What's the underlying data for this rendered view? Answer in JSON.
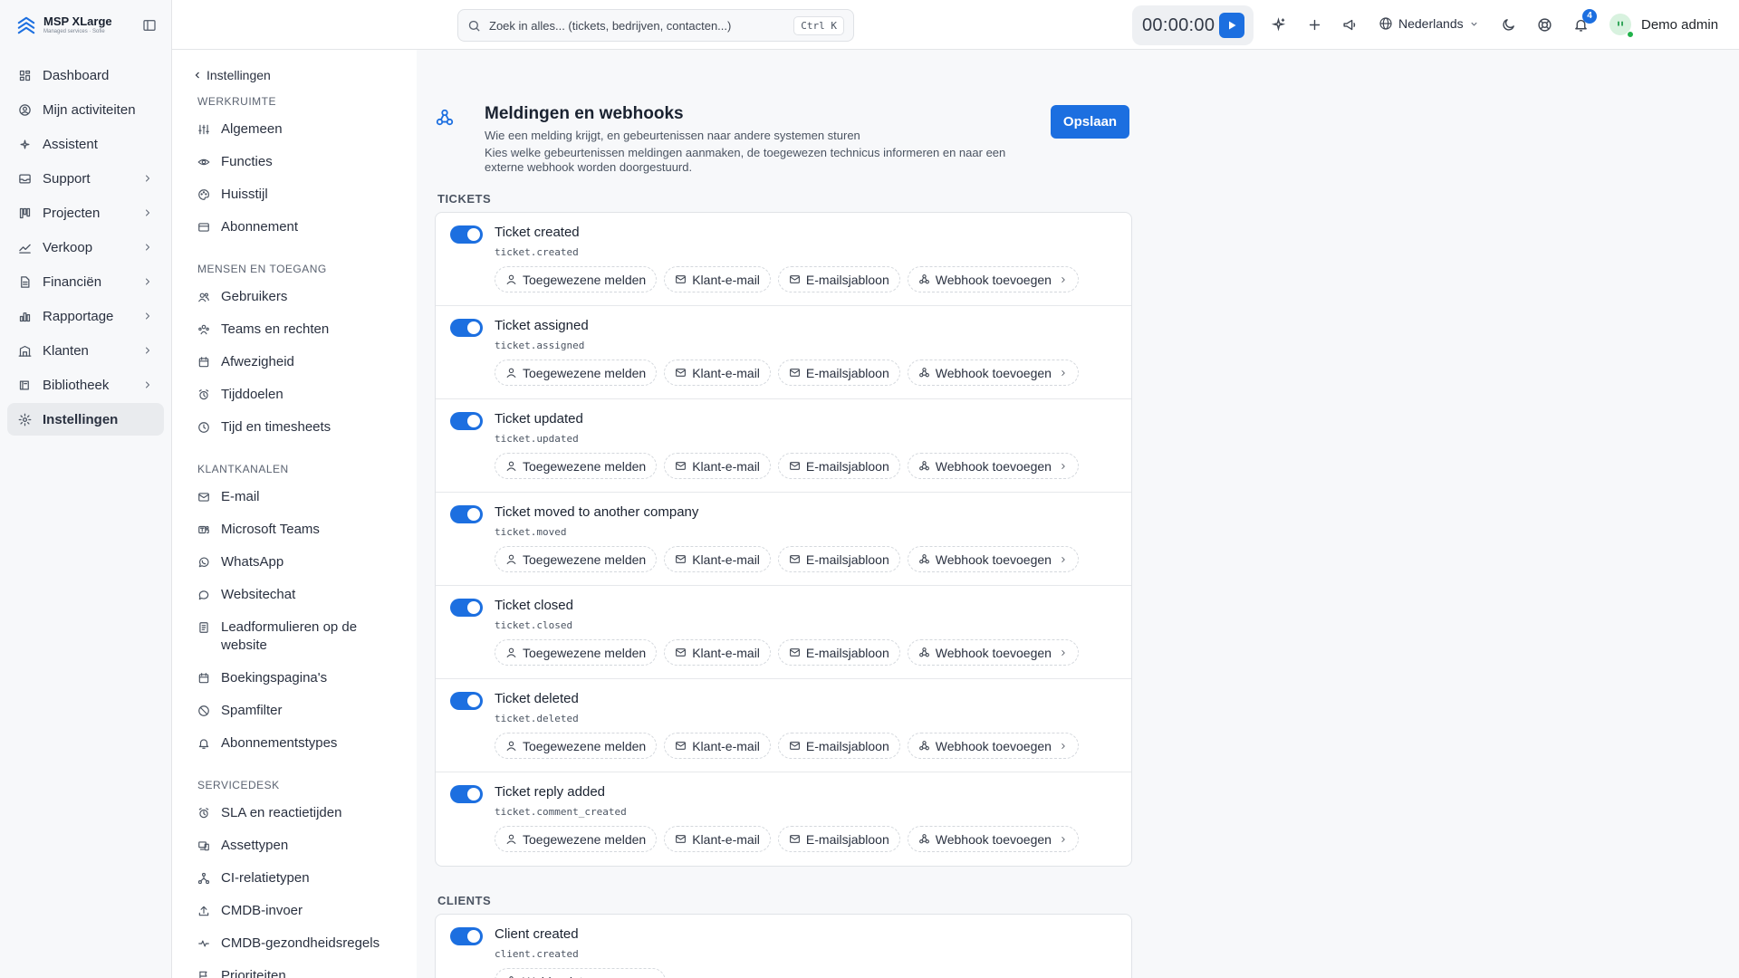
{
  "brand": {
    "name": "MSP XLarge",
    "subtitle": "Managed services · Sofie"
  },
  "sidebar": {
    "items": [
      {
        "label": "Dashboard",
        "icon": "dashboard-icon",
        "has_children": false,
        "active": false
      },
      {
        "label": "Mijn activiteiten",
        "icon": "user-circle-icon",
        "has_children": false,
        "active": false
      },
      {
        "label": "Assistent",
        "icon": "sparkle-icon",
        "has_children": false,
        "active": false
      },
      {
        "label": "Support",
        "icon": "inbox-icon",
        "has_children": true,
        "active": false
      },
      {
        "label": "Projecten",
        "icon": "kanban-icon",
        "has_children": true,
        "active": false
      },
      {
        "label": "Verkoop",
        "icon": "trend-icon",
        "has_children": true,
        "active": false
      },
      {
        "label": "Financiën",
        "icon": "document-icon",
        "has_children": true,
        "active": false
      },
      {
        "label": "Rapportage",
        "icon": "bar-chart-icon",
        "has_children": true,
        "active": false
      },
      {
        "label": "Klanten",
        "icon": "building-icon",
        "has_children": true,
        "active": false
      },
      {
        "label": "Bibliotheek",
        "icon": "book-icon",
        "has_children": true,
        "active": false
      },
      {
        "label": "Instellingen",
        "icon": "gear-icon",
        "has_children": false,
        "active": true
      }
    ]
  },
  "topbar": {
    "search_placeholder": "Zoek in alles... (tickets, bedrijven, contacten...)",
    "shortcut": "Ctrl K",
    "timer": "00:00:00",
    "language": "Nederlands",
    "notification_count": "4",
    "user_name": "Demo admin"
  },
  "subnav": {
    "back_label": "Instellingen",
    "groups": [
      {
        "title": "WERKRUIMTE",
        "items": [
          {
            "label": "Algemeen",
            "icon": "sliders-icon"
          },
          {
            "label": "Functies",
            "icon": "eye-icon"
          },
          {
            "label": "Huisstijl",
            "icon": "palette-icon"
          },
          {
            "label": "Abonnement",
            "icon": "card-icon"
          }
        ]
      },
      {
        "title": "MENSEN EN TOEGANG",
        "items": [
          {
            "label": "Gebruikers",
            "icon": "users-icon"
          },
          {
            "label": "Teams en rechten",
            "icon": "team-icon"
          },
          {
            "label": "Afwezigheid",
            "icon": "calendar-icon"
          },
          {
            "label": "Tijddoelen",
            "icon": "alarm-icon"
          },
          {
            "label": "Tijd en timesheets",
            "icon": "clock-icon"
          }
        ]
      },
      {
        "title": "KLANTKANALEN",
        "items": [
          {
            "label": "E-mail",
            "icon": "mail-icon"
          },
          {
            "label": "Microsoft Teams",
            "icon": "teams-icon"
          },
          {
            "label": "WhatsApp",
            "icon": "whatsapp-icon"
          },
          {
            "label": "Websitechat",
            "icon": "chat-icon"
          },
          {
            "label": "Leadformulieren op de website",
            "icon": "form-icon"
          },
          {
            "label": "Boekingspagina's",
            "icon": "calendar-icon"
          },
          {
            "label": "Spamfilter",
            "icon": "ban-icon"
          },
          {
            "label": "Abonnementstypes",
            "icon": "bell-icon"
          }
        ]
      },
      {
        "title": "SERVICEDESK",
        "items": [
          {
            "label": "SLA en reactietijden",
            "icon": "alarm-icon"
          },
          {
            "label": "Assettypen",
            "icon": "devices-icon"
          },
          {
            "label": "CI-relatietypen",
            "icon": "network-icon"
          },
          {
            "label": "CMDB-invoer",
            "icon": "upload-icon"
          },
          {
            "label": "CMDB-gezondheidsregels",
            "icon": "pulse-icon"
          },
          {
            "label": "Prioriteiten",
            "icon": "flag-icon"
          }
        ]
      }
    ]
  },
  "main": {
    "title": "Meldingen en webhooks",
    "subtitle": "Wie een melding krijgt, en gebeurtenissen naar andere systemen sturen",
    "description": "Kies welke gebeurtenissen meldingen aanmaken, de toegewezen technicus informeren en naar een externe webhook worden doorgestuurd.",
    "save_label": "Opslaan",
    "chip_labels": {
      "notify_assignee": "Toegewezene melden",
      "client_email": "Klant-e-mail",
      "email_template": "E-mailsjabloon",
      "add_webhook": "Webhook toevoegen"
    },
    "sections": [
      {
        "title": "TICKETS",
        "events": [
          {
            "title": "Ticket created",
            "code": "ticket.created",
            "enabled": true
          },
          {
            "title": "Ticket assigned",
            "code": "ticket.assigned",
            "enabled": true
          },
          {
            "title": "Ticket updated",
            "code": "ticket.updated",
            "enabled": true
          },
          {
            "title": "Ticket moved to another company",
            "code": "ticket.moved",
            "enabled": true
          },
          {
            "title": "Ticket closed",
            "code": "ticket.closed",
            "enabled": true
          },
          {
            "title": "Ticket deleted",
            "code": "ticket.deleted",
            "enabled": true
          },
          {
            "title": "Ticket reply added",
            "code": "ticket.comment_created",
            "enabled": true
          }
        ]
      },
      {
        "title": "CLIENTS",
        "events": [
          {
            "title": "Client created",
            "code": "client.created",
            "enabled": true
          }
        ]
      }
    ]
  }
}
